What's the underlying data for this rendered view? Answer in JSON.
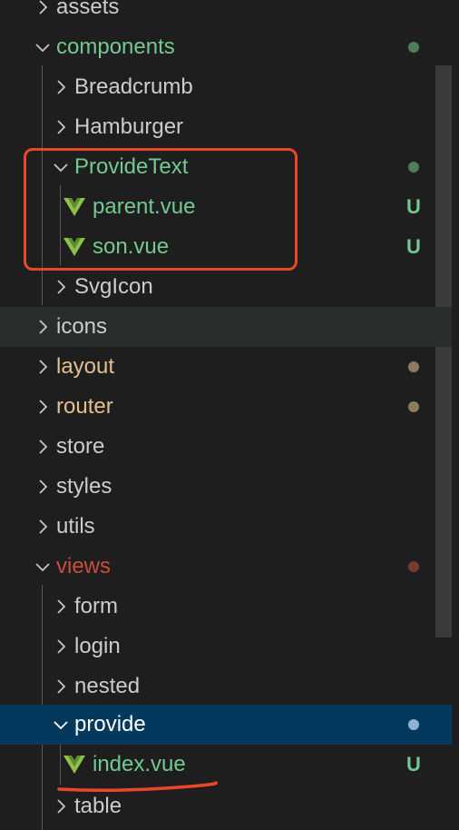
{
  "theme": {
    "text_default": "#cccccc",
    "text_untracked": "#73c991",
    "text_modified": "#e2c08d",
    "text_error": "#c74e39",
    "dot_green": "#4f7d5b",
    "dot_amber": "#8c7b5e",
    "dot_red": "#7a3b34",
    "dot_selected": "#8fb2d3",
    "vue_green": "#8dc149",
    "annotation_red": "#e8472a"
  },
  "explorer": {
    "items": [
      {
        "label": "assets",
        "type": "folder",
        "expanded": false
      },
      {
        "label": "components",
        "type": "folder",
        "expanded": true,
        "status": "untracked-dot"
      },
      {
        "label": "Breadcrumb",
        "type": "folder",
        "expanded": false
      },
      {
        "label": "Hamburger",
        "type": "folder",
        "expanded": false
      },
      {
        "label": "ProvideText",
        "type": "folder",
        "expanded": true,
        "status": "untracked-dot"
      },
      {
        "label": "parent.vue",
        "type": "vue-file",
        "badge": "U"
      },
      {
        "label": "son.vue",
        "type": "vue-file",
        "badge": "U"
      },
      {
        "label": "SvgIcon",
        "type": "folder",
        "expanded": false
      },
      {
        "label": "icons",
        "type": "folder",
        "expanded": false,
        "hovered": true
      },
      {
        "label": "layout",
        "type": "folder",
        "expanded": false,
        "status": "modified-dot"
      },
      {
        "label": "router",
        "type": "folder",
        "expanded": false,
        "status": "modified-dot"
      },
      {
        "label": "store",
        "type": "folder",
        "expanded": false
      },
      {
        "label": "styles",
        "type": "folder",
        "expanded": false
      },
      {
        "label": "utils",
        "type": "folder",
        "expanded": false
      },
      {
        "label": "views",
        "type": "folder",
        "expanded": true,
        "status": "error-dot"
      },
      {
        "label": "form",
        "type": "folder",
        "expanded": false
      },
      {
        "label": "login",
        "type": "folder",
        "expanded": false
      },
      {
        "label": "nested",
        "type": "folder",
        "expanded": false
      },
      {
        "label": "provide",
        "type": "folder",
        "expanded": true,
        "selected": true,
        "status": "selected-dot"
      },
      {
        "label": "index.vue",
        "type": "vue-file",
        "badge": "U"
      },
      {
        "label": "table",
        "type": "folder",
        "expanded": false
      }
    ]
  }
}
